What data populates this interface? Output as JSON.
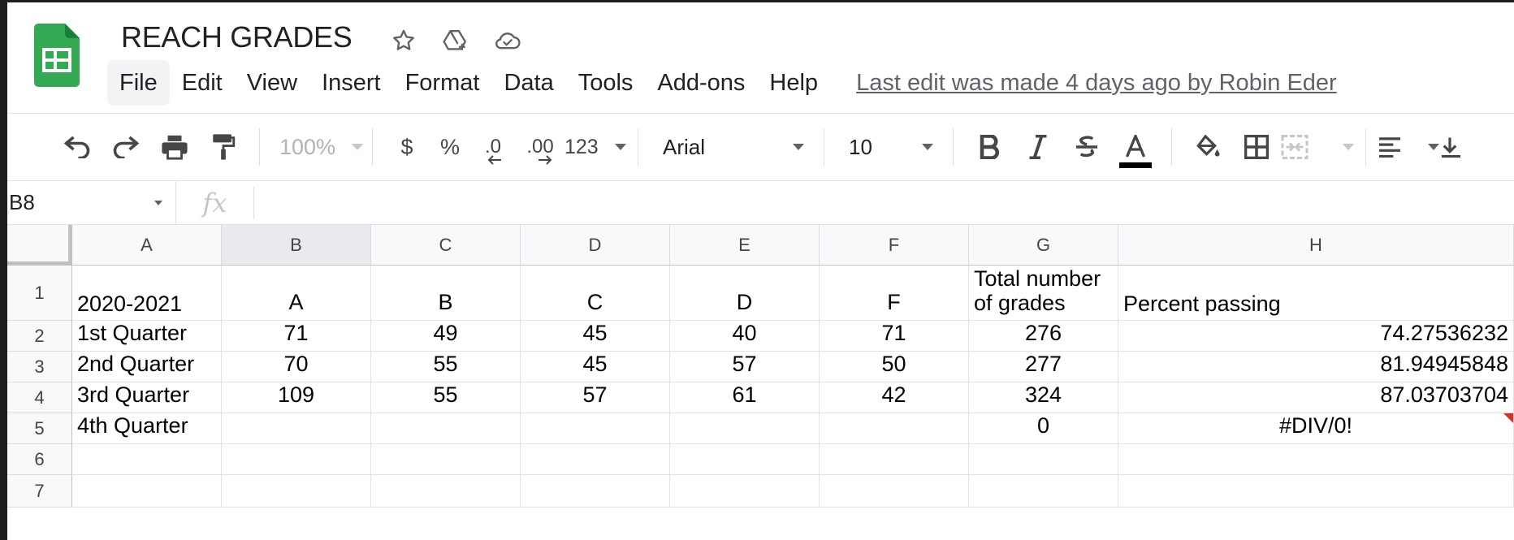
{
  "doc": {
    "title": "REACH GRADES",
    "last_edit": "Last edit was made 4 days ago by Robin Eder"
  },
  "menu": [
    "File",
    "Edit",
    "View",
    "Insert",
    "Format",
    "Data",
    "Tools",
    "Add-ons",
    "Help"
  ],
  "toolbar": {
    "zoom": "100%",
    "currency": "$",
    "percent": "%",
    "dec_decrease": ".0",
    "dec_increase": ".00",
    "more_formats": "123",
    "font": "Arial",
    "font_size": "10",
    "text_color": "#000000"
  },
  "formula_bar": {
    "name_box": "B8",
    "fx": "fx",
    "value": ""
  },
  "sheet": {
    "columns": [
      "A",
      "B",
      "C",
      "D",
      "E",
      "F",
      "G",
      "H"
    ],
    "row_numbers": [
      "1",
      "2",
      "3",
      "4",
      "5",
      "6",
      "7"
    ],
    "selected_column": "B",
    "rows": [
      [
        "2020-2021",
        "A",
        "B",
        "C",
        "D",
        "F",
        "Total number of grades",
        "Percent passing"
      ],
      [
        "1st Quarter",
        "71",
        "49",
        "45",
        "40",
        "71",
        "276",
        "74.27536232"
      ],
      [
        "2nd Quarter",
        "70",
        "55",
        "45",
        "57",
        "50",
        "277",
        "81.94945848"
      ],
      [
        "3rd Quarter",
        "109",
        "55",
        "57",
        "61",
        "42",
        "324",
        "87.03703704"
      ],
      [
        "4th Quarter",
        "",
        "",
        "",
        "",
        "",
        "0",
        "#DIV/0!"
      ],
      [
        "",
        "",
        "",
        "",
        "",
        "",
        "",
        ""
      ],
      [
        "",
        "",
        "",
        "",
        "",
        "",
        "",
        ""
      ]
    ],
    "note_cell": "H5",
    "note_color": "#d93025"
  }
}
